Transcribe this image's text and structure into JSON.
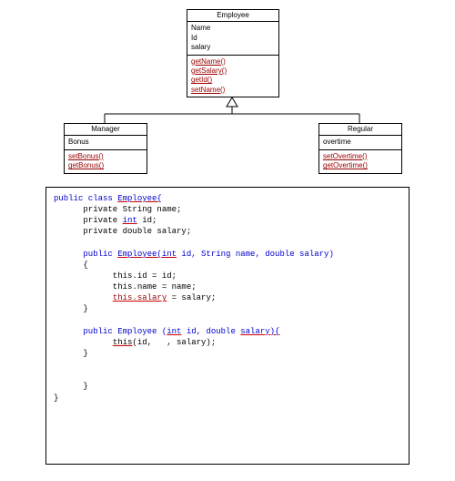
{
  "uml": {
    "employee": {
      "title": "Employee",
      "attrs": [
        "Name",
        "Id",
        "salary"
      ],
      "methods": [
        "getName()",
        "getSalary()",
        "getId()",
        "setName()"
      ]
    },
    "manager": {
      "title": "Manager",
      "attrs": [
        "Bonus"
      ],
      "methods": [
        "setBonus()",
        "getBonus()"
      ]
    },
    "regular": {
      "title": "Regular",
      "attrs": [
        "overtime"
      ],
      "methods": [
        "setOvertime()",
        "getOvertime()"
      ]
    }
  },
  "code": {
    "l1a": "public class ",
    "l1b": "Employee{",
    "l2a": "      private String name;",
    "l3a": "      private ",
    "l3b": "int",
    "l3c": " id;",
    "l4a": "      private double salary;",
    "l5a": "      public ",
    "l5b": "Employee(",
    "l5c": "int",
    "l5d": " id, String name, double salary)",
    "l6a": "      {",
    "l7a": "            this.id = id;",
    "l8a": "            this.name = name;",
    "l9a": "            ",
    "l9b": "this.salary",
    "l9c": " = salary;",
    "l10a": "      }",
    "l11a": "      public Employee (",
    "l11b": "int",
    "l11c": " id, double ",
    "l11d": "salary){",
    "l12a": "            ",
    "l12b": "this",
    "l12c": "(id,   , salary);",
    "l13a": "      }",
    "l14a": "",
    "l15a": "      }",
    "l16a": "}"
  }
}
